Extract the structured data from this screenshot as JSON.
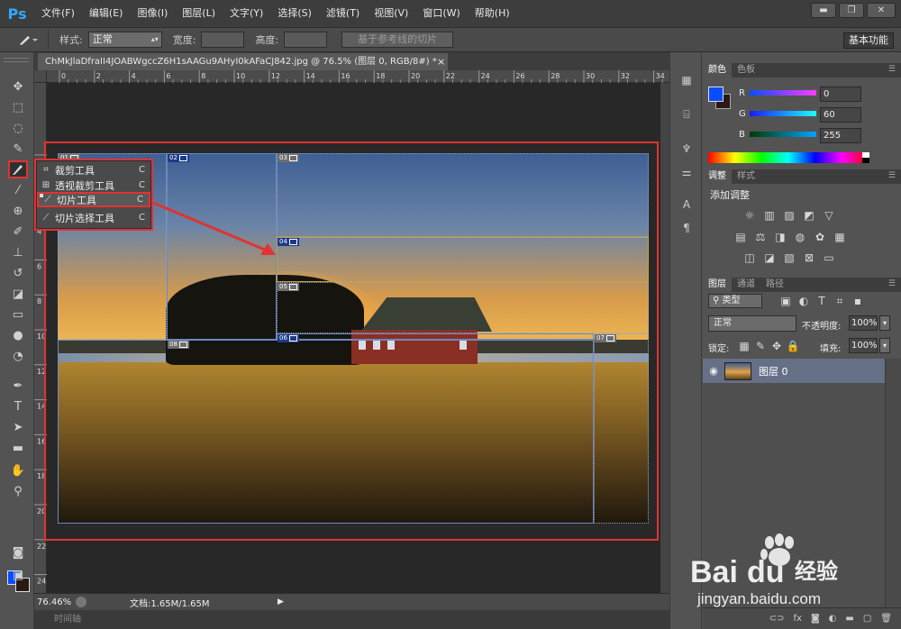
{
  "app": {
    "logo": "Ps",
    "menu": [
      "文件(F)",
      "编辑(E)",
      "图像(I)",
      "图层(L)",
      "文字(Y)",
      "选择(S)",
      "滤镜(T)",
      "视图(V)",
      "窗口(W)",
      "帮助(H)"
    ],
    "window_controls": [
      "▬",
      "❐",
      "✕"
    ]
  },
  "options": {
    "style_label": "样式:",
    "style_value": "正常",
    "width_label": "宽度:",
    "height_label": "高度:",
    "guides_button": "基于参考线的切片",
    "workspace": "基本功能"
  },
  "document": {
    "tab_title": "ChMkJlaDfraII4JOABWgccZ6H1sAAGu9AHyI0kAFaCJ842.jpg @ 76.5% (图层 0, RGB/8#) *",
    "tab_close": "×",
    "zoom": "76.46%",
    "doc_size": "文档:1.65M/1.65M",
    "timeline": "时间轴",
    "ruler_top": [
      "0",
      "2",
      "4",
      "6",
      "8",
      "10",
      "12",
      "14",
      "16",
      "18",
      "20",
      "22",
      "24",
      "26",
      "28",
      "30",
      "32",
      "34"
    ],
    "ruler_left": [
      "0",
      "2",
      "4",
      "6",
      "8",
      "10",
      "12",
      "14",
      "16",
      "18",
      "20",
      "22",
      "24"
    ]
  },
  "flyout": {
    "items": [
      {
        "label": "裁剪工具",
        "key": "C"
      },
      {
        "label": "透视裁剪工具",
        "key": "C"
      },
      {
        "label": "切片工具",
        "key": "C"
      },
      {
        "label": "切片选择工具",
        "key": "C"
      }
    ]
  },
  "slices": [
    "01",
    "02",
    "03",
    "04",
    "05",
    "06",
    "07",
    "08"
  ],
  "panels": {
    "color": {
      "tabs": [
        "颜色",
        "色板"
      ],
      "r_label": "R",
      "r": "0",
      "g_label": "G",
      "g": "60",
      "b_label": "B",
      "b": "255"
    },
    "adjust": {
      "tabs": [
        "调整",
        "样式"
      ],
      "title": "添加调整"
    },
    "layers": {
      "tabs": [
        "图层",
        "通道",
        "路径"
      ],
      "kind": "类型",
      "blend": "正常",
      "opacity_label": "不透明度:",
      "opacity": "100%",
      "lock_label": "锁定:",
      "fill_label": "填充:",
      "fill": "100%",
      "layer_name": "图层 0"
    }
  },
  "watermark": {
    "brand": "Bai",
    "brand2": "du",
    "cn": "经验",
    "url": "jingyan.baidu.com"
  },
  "colors": {
    "accent_red": "#e03333",
    "fg": "#0a4cff",
    "bg": "#2a1a14"
  }
}
